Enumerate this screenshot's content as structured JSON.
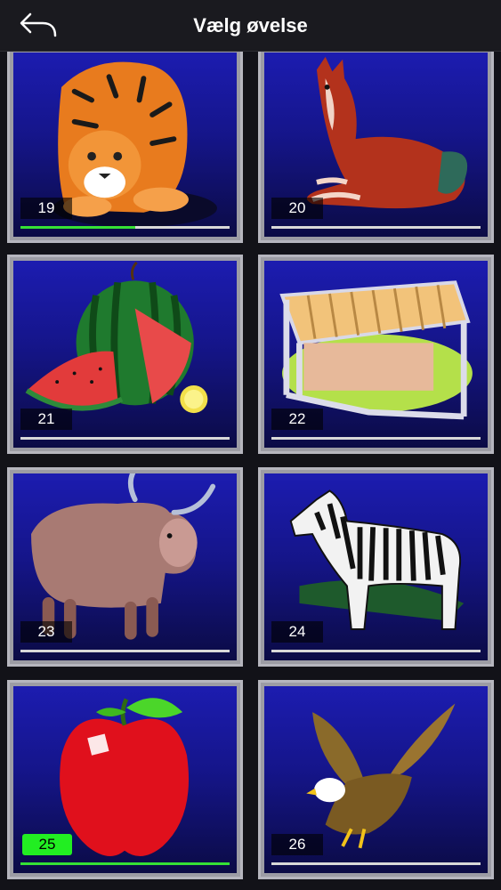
{
  "header": {
    "title": "Vælg øvelse",
    "back_icon": "back-arrow-icon"
  },
  "exercises": [
    {
      "number": "19",
      "subject": "tiger",
      "progress": 0.55,
      "completed": false
    },
    {
      "number": "20",
      "subject": "fox",
      "progress": 0,
      "completed": false
    },
    {
      "number": "21",
      "subject": "watermelon",
      "progress": 0,
      "completed": false
    },
    {
      "number": "22",
      "subject": "xylophone",
      "progress": 0,
      "completed": false
    },
    {
      "number": "23",
      "subject": "yak",
      "progress": 0,
      "completed": false
    },
    {
      "number": "24",
      "subject": "zebra",
      "progress": 0,
      "completed": false
    },
    {
      "number": "25",
      "subject": "apple",
      "progress": 1,
      "completed": true
    },
    {
      "number": "26",
      "subject": "eagle",
      "progress": 0,
      "completed": false
    }
  ],
  "colors": {
    "badge_completed": "#22ee22",
    "progress_fill": "#35e035",
    "tile_background": "#15158a"
  }
}
